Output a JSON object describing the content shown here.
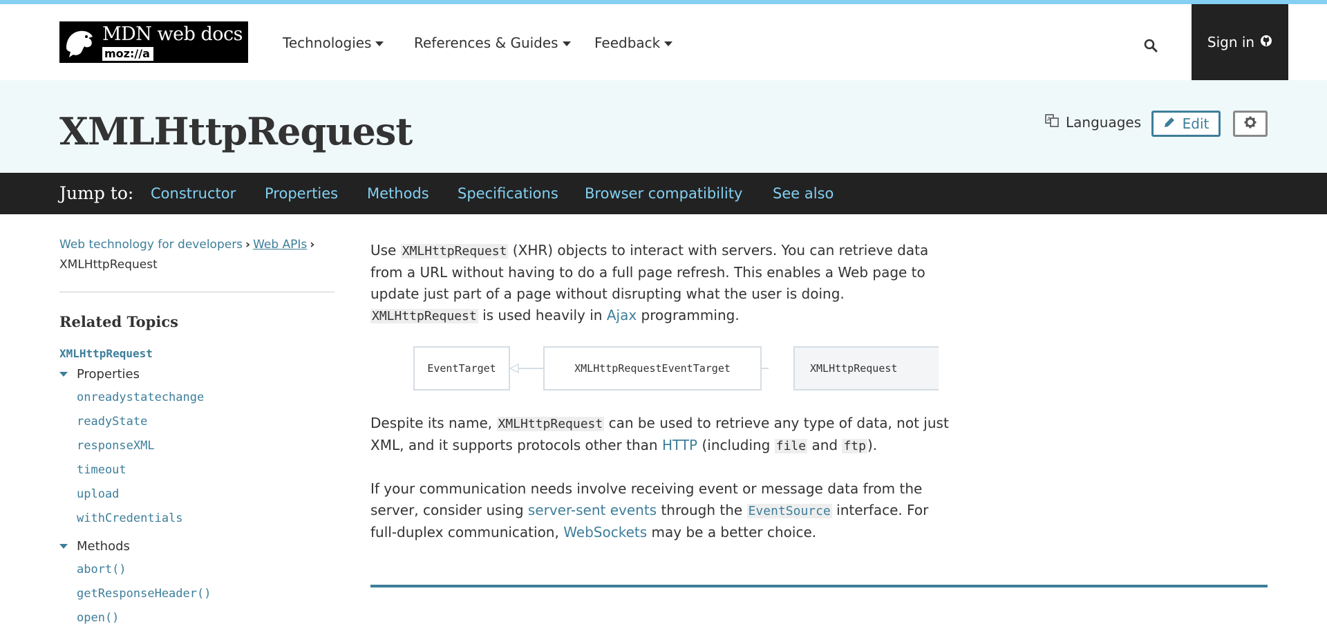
{
  "header": {
    "logo_text": "MDN web docs",
    "logo_sub": "moz://a",
    "nav": [
      {
        "label": "Technologies"
      },
      {
        "label": "References & Guides"
      },
      {
        "label": "Feedback"
      }
    ],
    "signin_label": "Sign in"
  },
  "title_bar": {
    "title": "XMLHttpRequest",
    "languages_label": "Languages",
    "edit_label": "Edit"
  },
  "jump_bar": {
    "label": "Jump to:",
    "links": [
      "Constructor",
      "Properties",
      "Methods",
      "Specifications",
      "Browser compatibility",
      "See also"
    ]
  },
  "sidebar": {
    "breadcrumb": [
      "Web technology for developers",
      "Web APIs",
      "XMLHttpRequest"
    ],
    "related_title": "Related Topics",
    "main_link": "XMLHttpRequest",
    "properties_label": "Properties",
    "properties": [
      "onreadystatechange",
      "readyState",
      "responseXML",
      "timeout",
      "upload",
      "withCredentials"
    ],
    "methods_label": "Methods",
    "methods": [
      "abort()",
      "getResponseHeader()",
      "open()"
    ]
  },
  "content": {
    "p1": {
      "a": "Use ",
      "code1": "XMLHttpRequest",
      "b": " (XHR) objects to interact with servers. You can retrieve data from a URL without having to do a full page refresh. This enables a Web page to update just part of a page without disrupting what the user is doing. ",
      "code2": "XMLHttpRequest",
      "c": " is used heavily in ",
      "link": "Ajax",
      "d": " programming."
    },
    "diagram": [
      "EventTarget",
      "XMLHttpRequestEventTarget",
      "XMLHttpRequest"
    ],
    "p2": {
      "a": "Despite its name, ",
      "code1": "XMLHttpRequest",
      "b": " can be used to retrieve any type of data, not just XML, and it supports protocols other than ",
      "link": "HTTP",
      "c": " (including ",
      "code2": "file",
      "d": " and ",
      "code3": "ftp",
      "e": ")."
    },
    "p3": {
      "a": "If your communication needs involve receiving event or message data from the server, consider using ",
      "link1": "server-sent events",
      "b": " through the ",
      "code1": "EventSource",
      "c": " interface. For full-duplex communication, ",
      "link2": "WebSockets",
      "d": " may be a better choice."
    }
  },
  "colors": {
    "accent_bar": "#83d0f2",
    "link": "#3d7e9a",
    "jump_bar_bg": "#222222",
    "title_bar_bg": "#f0f9fa"
  }
}
